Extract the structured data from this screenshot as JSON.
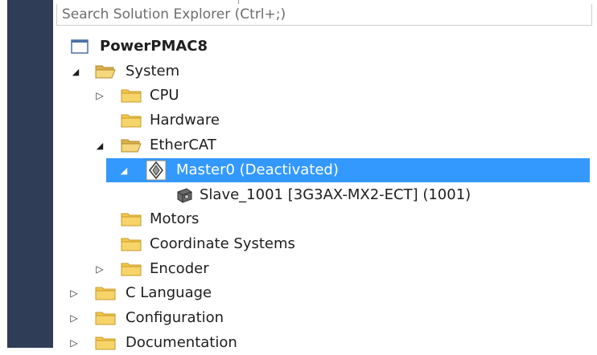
{
  "search": {
    "placeholder": "Search Solution Explorer (Ctrl+;)"
  },
  "tree": {
    "project": {
      "label": "PowerPMAC8"
    },
    "system": {
      "label": "System"
    },
    "cpu": {
      "label": "CPU"
    },
    "hardware": {
      "label": "Hardware"
    },
    "ethercat": {
      "label": "EtherCAT"
    },
    "master0": {
      "label": "Master0 (Deactivated)"
    },
    "slave": {
      "label": "Slave_1001 [3G3AX-MX2-ECT] (1001)"
    },
    "motors": {
      "label": "Motors"
    },
    "coordinate_systems": {
      "label": "Coordinate Systems"
    },
    "encoder": {
      "label": "Encoder"
    },
    "c_language": {
      "label": "C Language"
    },
    "configuration": {
      "label": "Configuration"
    },
    "documentation": {
      "label": "Documentation"
    }
  },
  "colors": {
    "selection": "#3399ff",
    "folder": "#f5c84a",
    "sidebar": "#2f3d56"
  }
}
